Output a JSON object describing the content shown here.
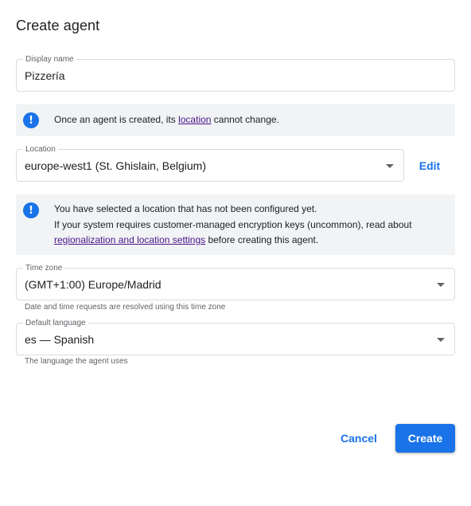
{
  "dialog": {
    "title": "Create agent"
  },
  "display_name": {
    "label": "Display name",
    "value": "Pizzería"
  },
  "location_notice": {
    "icon": "info-icon",
    "prefix": "Once an agent is created, its ",
    "link": "location",
    "suffix": " cannot change."
  },
  "location": {
    "label": "Location",
    "value": "europe-west1 (St. Ghislain, Belgium)",
    "edit_label": "Edit"
  },
  "config_notice": {
    "icon": "info-icon",
    "line1": "You have selected a location that has not been configured yet.",
    "line2": "If your system requires customer-managed encryption keys (uncommon), read about",
    "link": "regionalization and location settings",
    "line3_suffix": " before creating this agent."
  },
  "time_zone": {
    "label": "Time zone",
    "value": "(GMT+1:00) Europe/Madrid",
    "hint": "Date and time requests are resolved using this time zone"
  },
  "default_language": {
    "label": "Default language",
    "value": "es — Spanish",
    "hint": "The language the agent uses"
  },
  "actions": {
    "cancel_label": "Cancel",
    "create_label": "Create"
  },
  "colors": {
    "accent": "#1a73e8",
    "link_visited": "#4a148c",
    "notice_bg": "#f1f3f4"
  }
}
